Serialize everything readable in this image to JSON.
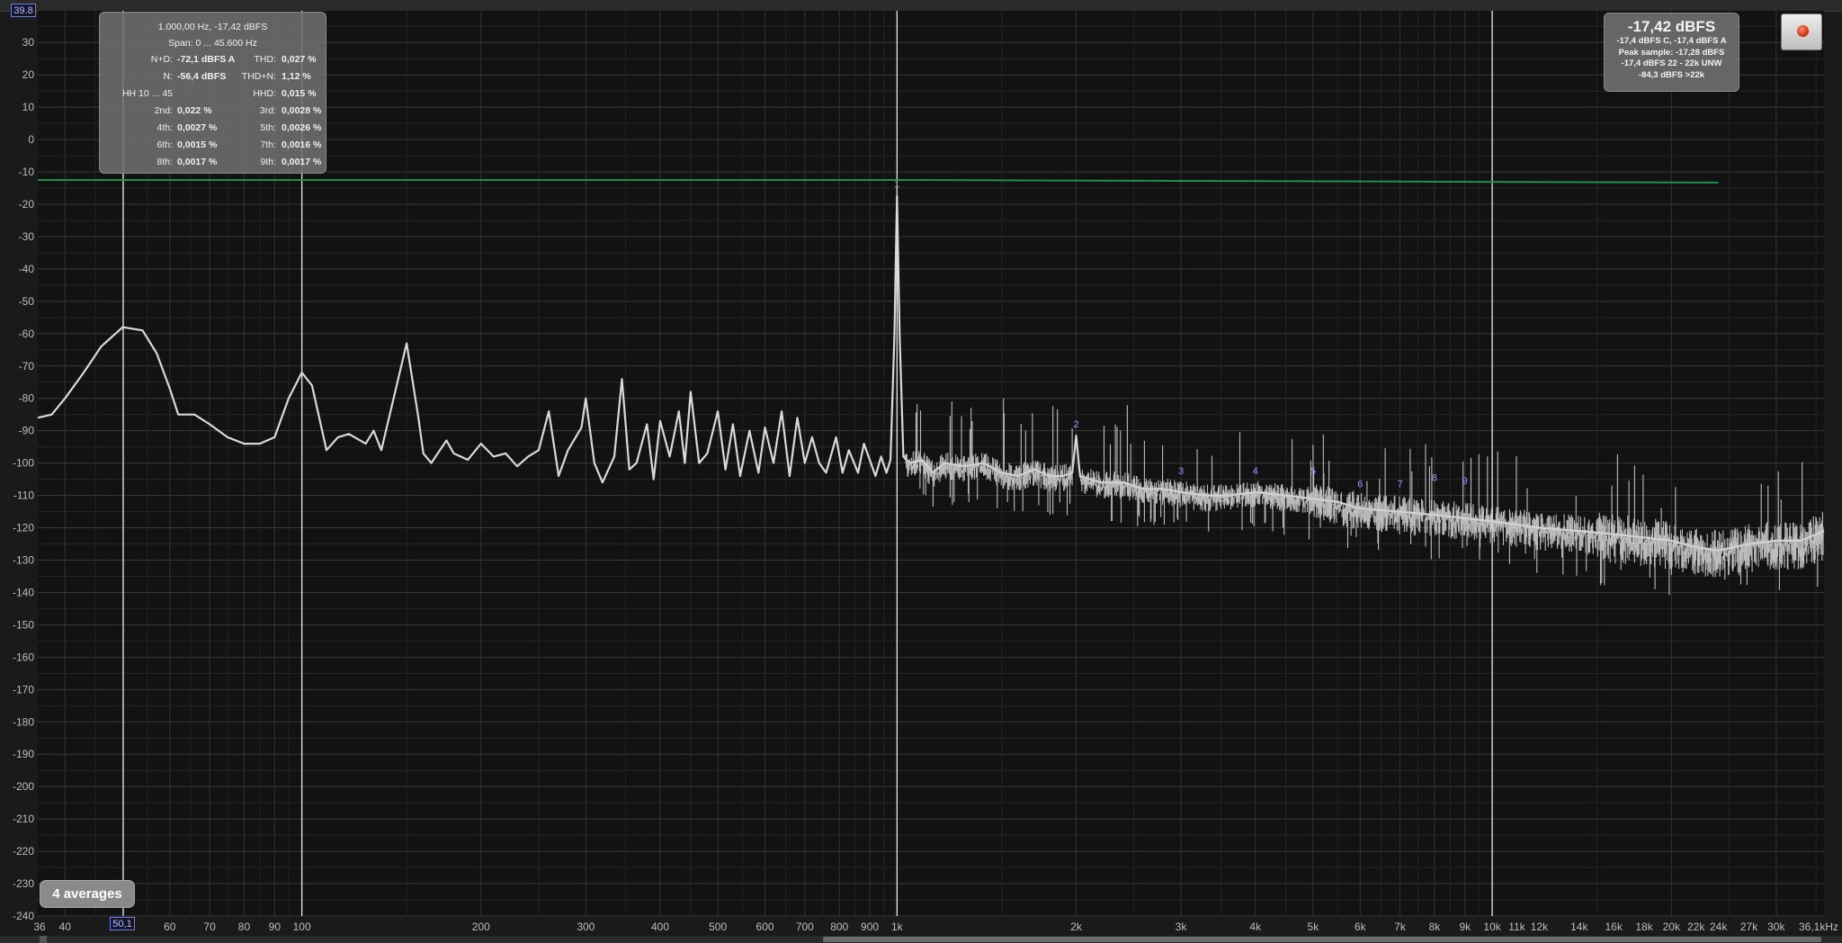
{
  "y_axis": {
    "top_value": "39.8",
    "labels": [
      "30",
      "20",
      "10",
      "0",
      "-10",
      "-20",
      "-30",
      "-40",
      "-50",
      "-60",
      "-70",
      "-80",
      "-90",
      "-100",
      "-110",
      "-120",
      "-130",
      "-140",
      "-150",
      "-160",
      "-170",
      "-180",
      "-190",
      "-200",
      "-210",
      "-220",
      "-230",
      "-240"
    ]
  },
  "x_axis": {
    "labels": [
      "36",
      "40",
      "60",
      "70",
      "80",
      "90",
      "100",
      "200",
      "300",
      "400",
      "500",
      "600",
      "700",
      "800",
      "900",
      "1k",
      "2k",
      "3k",
      "4k",
      "5k",
      "6k",
      "7k",
      "8k",
      "9k",
      "10k",
      "11k",
      "12k",
      "14k",
      "16k",
      "18k",
      "20k",
      "22k",
      "24k",
      "27k",
      "30k",
      "36,1kHz"
    ],
    "cursor_value": "50,1"
  },
  "info_box": {
    "title": "1.000,00 Hz, -17,42 dBFS",
    "span": "Span: 0 ... 45.600 Hz",
    "rows": [
      {
        "lk": "N+D:",
        "lv": "-72,1 dBFS A",
        "rk": "THD:",
        "rv": "0,027 %"
      },
      {
        "lk": "N:",
        "lv": "-56,4 dBFS",
        "rk": "THD+N:",
        "rv": "1,12 %"
      },
      {
        "lk": "HH 10 ... 45",
        "lv": "",
        "rk": "HHD:",
        "rv": "0,015 %"
      },
      {
        "lk": "2nd:",
        "lv": "0,022 %",
        "rk": "3rd:",
        "rv": "0,0028 %"
      },
      {
        "lk": "4th:",
        "lv": "0,0027 %",
        "rk": "5th:",
        "rv": "0,0026 %"
      },
      {
        "lk": "6th:",
        "lv": "0,0015 %",
        "rk": "7th:",
        "rv": "0,0016 %"
      },
      {
        "lk": "8th:",
        "lv": "0,0017 %",
        "rk": "9th:",
        "rv": "0,0017 %"
      }
    ]
  },
  "level_box": {
    "main": "-17,42 dBFS",
    "lines": [
      "-17,4 dBFS C, -17,4 dBFS A",
      "Peak sample: -17,28 dBFS",
      "-17,4 dBFS 22 - 22k UNW",
      "-84,3 dBFS >22k"
    ]
  },
  "averages_button": "4 averages",
  "harmonic_markers": [
    "1",
    "2",
    "3",
    "4",
    "5",
    "6",
    "7",
    "8",
    "9"
  ],
  "colors": {
    "background": "#121212",
    "grid": "#2e2e2e",
    "spectrum": "#d9d9d9",
    "reference_line": "#1f8f4a",
    "cursor": "#e6e6e6",
    "marker": "#8f9bff"
  },
  "chart_data": {
    "type": "line",
    "title": "",
    "xlabel": "",
    "ylabel": "",
    "x_scale": "log",
    "xlim": [
      36,
      36100
    ],
    "ylim": [
      -240,
      39.8
    ],
    "grid": true,
    "fundamental": {
      "freq_hz": 1000,
      "level_dbfs": -17.42
    },
    "reference_line": [
      {
        "x": 36,
        "y": -12.5
      },
      {
        "x": 1000,
        "y": -12.5
      },
      {
        "x": 24000,
        "y": -13.3
      }
    ],
    "cursors_hz": [
      50.1,
      100,
      1000,
      10000
    ],
    "harmonic_peaks": [
      {
        "n": "1",
        "x": 1000,
        "y": -17.4
      },
      {
        "n": "2",
        "x": 2000,
        "y": -91.5
      },
      {
        "n": "3",
        "x": 3000,
        "y": -106
      },
      {
        "n": "4",
        "x": 4000,
        "y": -106
      },
      {
        "n": "5",
        "x": 5000,
        "y": -106
      },
      {
        "n": "6",
        "x": 6000,
        "y": -110
      },
      {
        "n": "7",
        "x": 7000,
        "y": -110
      },
      {
        "n": "8",
        "x": 8000,
        "y": -108
      },
      {
        "n": "9",
        "x": 9000,
        "y": -109
      }
    ],
    "spectrum": [
      {
        "x": 36,
        "y": -86
      },
      {
        "x": 38,
        "y": -85
      },
      {
        "x": 40,
        "y": -80
      },
      {
        "x": 43,
        "y": -72
      },
      {
        "x": 46,
        "y": -64
      },
      {
        "x": 50,
        "y": -58
      },
      {
        "x": 54,
        "y": -59
      },
      {
        "x": 57,
        "y": -66
      },
      {
        "x": 60,
        "y": -77
      },
      {
        "x": 62,
        "y": -85
      },
      {
        "x": 66,
        "y": -85
      },
      {
        "x": 70,
        "y": -88
      },
      {
        "x": 75,
        "y": -92
      },
      {
        "x": 80,
        "y": -94
      },
      {
        "x": 85,
        "y": -94
      },
      {
        "x": 90,
        "y": -92
      },
      {
        "x": 95,
        "y": -80
      },
      {
        "x": 100,
        "y": -72
      },
      {
        "x": 104,
        "y": -76
      },
      {
        "x": 110,
        "y": -96
      },
      {
        "x": 115,
        "y": -92
      },
      {
        "x": 120,
        "y": -91
      },
      {
        "x": 128,
        "y": -94
      },
      {
        "x": 132,
        "y": -90
      },
      {
        "x": 136,
        "y": -96
      },
      {
        "x": 150,
        "y": -63
      },
      {
        "x": 157,
        "y": -86
      },
      {
        "x": 160,
        "y": -97
      },
      {
        "x": 165,
        "y": -100
      },
      {
        "x": 175,
        "y": -93
      },
      {
        "x": 180,
        "y": -97
      },
      {
        "x": 190,
        "y": -99
      },
      {
        "x": 200,
        "y": -94
      },
      {
        "x": 210,
        "y": -98
      },
      {
        "x": 220,
        "y": -97
      },
      {
        "x": 230,
        "y": -101
      },
      {
        "x": 240,
        "y": -98
      },
      {
        "x": 250,
        "y": -96
      },
      {
        "x": 260,
        "y": -84
      },
      {
        "x": 270,
        "y": -104
      },
      {
        "x": 280,
        "y": -96
      },
      {
        "x": 295,
        "y": -89
      },
      {
        "x": 300,
        "y": -80
      },
      {
        "x": 310,
        "y": -100
      },
      {
        "x": 320,
        "y": -106
      },
      {
        "x": 335,
        "y": -98
      },
      {
        "x": 345,
        "y": -74
      },
      {
        "x": 355,
        "y": -102
      },
      {
        "x": 365,
        "y": -100
      },
      {
        "x": 380,
        "y": -88
      },
      {
        "x": 390,
        "y": -105
      },
      {
        "x": 400,
        "y": -87
      },
      {
        "x": 415,
        "y": -98
      },
      {
        "x": 430,
        "y": -84
      },
      {
        "x": 440,
        "y": -100
      },
      {
        "x": 450,
        "y": -78
      },
      {
        "x": 465,
        "y": -100
      },
      {
        "x": 480,
        "y": -97
      },
      {
        "x": 500,
        "y": -84
      },
      {
        "x": 515,
        "y": -102
      },
      {
        "x": 530,
        "y": -88
      },
      {
        "x": 545,
        "y": -104
      },
      {
        "x": 565,
        "y": -90
      },
      {
        "x": 585,
        "y": -103
      },
      {
        "x": 600,
        "y": -89
      },
      {
        "x": 620,
        "y": -100
      },
      {
        "x": 640,
        "y": -84
      },
      {
        "x": 660,
        "y": -104
      },
      {
        "x": 680,
        "y": -86
      },
      {
        "x": 700,
        "y": -100
      },
      {
        "x": 720,
        "y": -92
      },
      {
        "x": 740,
        "y": -100
      },
      {
        "x": 760,
        "y": -103
      },
      {
        "x": 790,
        "y": -92
      },
      {
        "x": 810,
        "y": -103
      },
      {
        "x": 830,
        "y": -96
      },
      {
        "x": 860,
        "y": -103
      },
      {
        "x": 880,
        "y": -94
      },
      {
        "x": 920,
        "y": -104
      },
      {
        "x": 940,
        "y": -98
      },
      {
        "x": 960,
        "y": -103
      },
      {
        "x": 975,
        "y": -99
      },
      {
        "x": 990,
        "y": -60
      },
      {
        "x": 1000,
        "y": -17.4
      },
      {
        "x": 1010,
        "y": -60
      },
      {
        "x": 1025,
        "y": -98
      },
      {
        "x": 1050,
        "y": -100
      },
      {
        "x": 1100,
        "y": -99
      },
      {
        "x": 1150,
        "y": -103
      },
      {
        "x": 1200,
        "y": -100
      },
      {
        "x": 1300,
        "y": -101
      },
      {
        "x": 1400,
        "y": -100
      },
      {
        "x": 1500,
        "y": -103
      },
      {
        "x": 1600,
        "y": -104
      },
      {
        "x": 1700,
        "y": -102
      },
      {
        "x": 1800,
        "y": -104
      },
      {
        "x": 1900,
        "y": -104
      },
      {
        "x": 1970,
        "y": -103
      },
      {
        "x": 2000,
        "y": -91.5
      },
      {
        "x": 2030,
        "y": -104
      },
      {
        "x": 2200,
        "y": -106
      },
      {
        "x": 2400,
        "y": -106
      },
      {
        "x": 2600,
        "y": -108
      },
      {
        "x": 2800,
        "y": -108
      },
      {
        "x": 3000,
        "y": -109
      },
      {
        "x": 3300,
        "y": -110
      },
      {
        "x": 3600,
        "y": -110
      },
      {
        "x": 4000,
        "y": -109
      },
      {
        "x": 4500,
        "y": -110
      },
      {
        "x": 5000,
        "y": -111
      },
      {
        "x": 5500,
        "y": -112
      },
      {
        "x": 6000,
        "y": -114
      },
      {
        "x": 7000,
        "y": -115
      },
      {
        "x": 8000,
        "y": -116
      },
      {
        "x": 9000,
        "y": -117
      },
      {
        "x": 10000,
        "y": -118
      },
      {
        "x": 11000,
        "y": -119
      },
      {
        "x": 12000,
        "y": -120
      },
      {
        "x": 14000,
        "y": -121
      },
      {
        "x": 16000,
        "y": -122
      },
      {
        "x": 18000,
        "y": -123
      },
      {
        "x": 20000,
        "y": -124
      },
      {
        "x": 22000,
        "y": -126
      },
      {
        "x": 24000,
        "y": -127
      },
      {
        "x": 27000,
        "y": -125
      },
      {
        "x": 30000,
        "y": -124
      },
      {
        "x": 33000,
        "y": -124
      },
      {
        "x": 36100,
        "y": -121
      }
    ]
  }
}
